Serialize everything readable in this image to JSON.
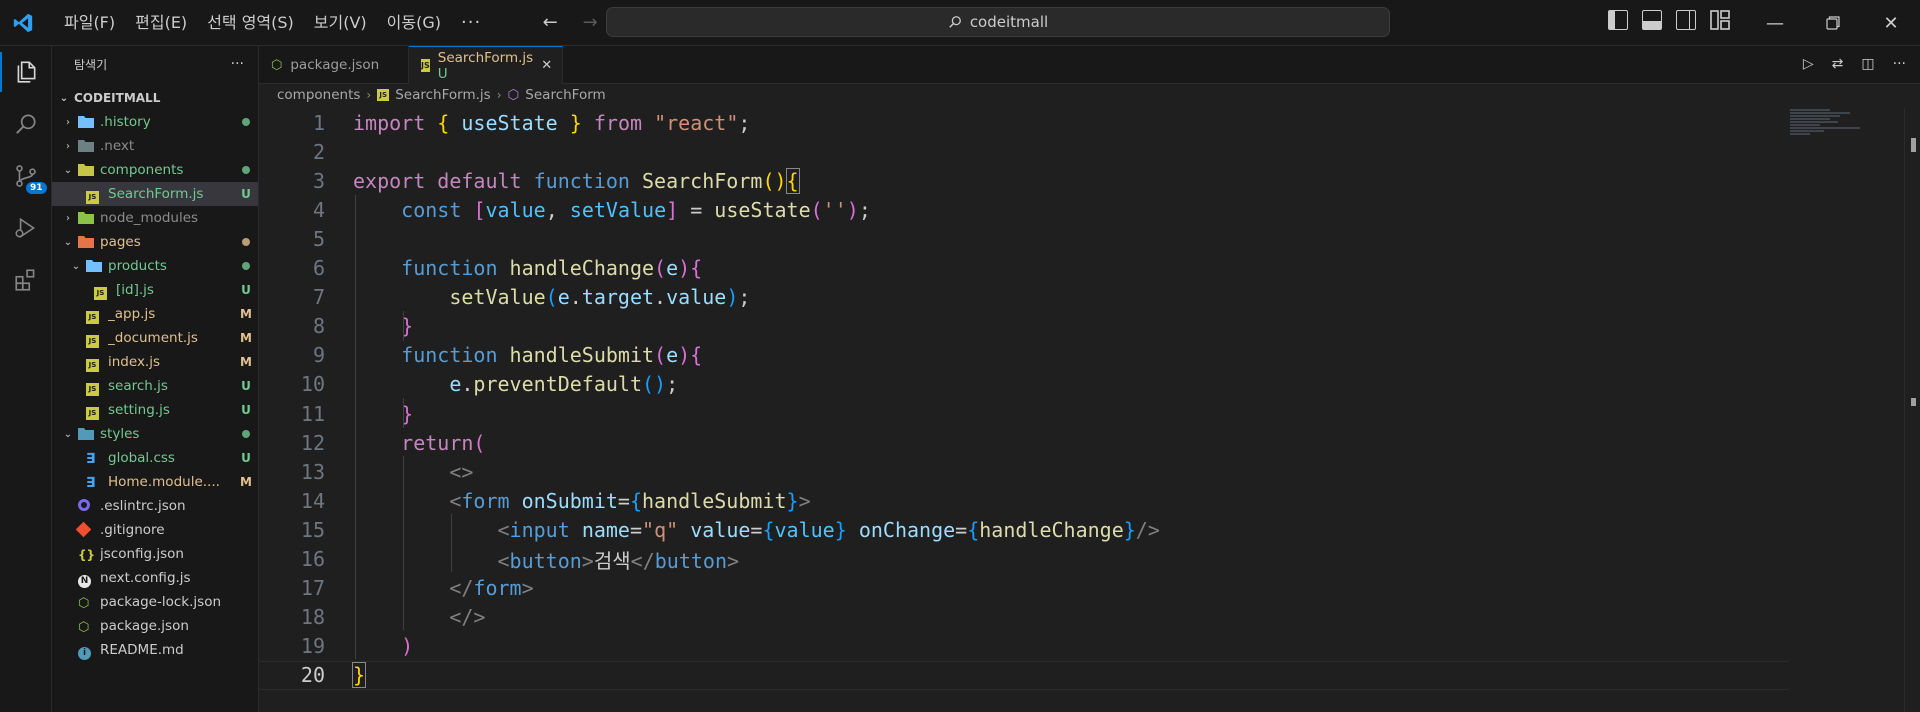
{
  "titlebar": {
    "menus": [
      "파일(F)",
      "편집(E)",
      "선택 영역(S)",
      "보기(V)",
      "이동(G)"
    ],
    "more": "···",
    "search": "codeitmall",
    "logo": "vscode-logo-icon"
  },
  "activity": {
    "scm_badge": "91"
  },
  "sidebar": {
    "title": "탐색기",
    "more": "···",
    "section": "CODEITMALL",
    "tree": [
      {
        "label": ".history",
        "status": "dot",
        "color": "#73c991"
      },
      {
        "label": ".next",
        "status": "",
        "color": "#8c8c8c"
      },
      {
        "label": "components",
        "status": "dot",
        "color": "#73c991"
      },
      {
        "label": "SearchForm.js",
        "status": "U",
        "color": "#73c991"
      },
      {
        "label": "node_modules",
        "status": "",
        "color": "#8c8c8c"
      },
      {
        "label": "pages",
        "status": "dot",
        "color": "#e2c08d"
      },
      {
        "label": "products",
        "status": "dot",
        "color": "#73c991"
      },
      {
        "label": "[id].js",
        "status": "U",
        "color": "#73c991"
      },
      {
        "label": "_app.js",
        "status": "M",
        "color": "#e2c08d"
      },
      {
        "label": "_document.js",
        "status": "M",
        "color": "#e2c08d"
      },
      {
        "label": "index.js",
        "status": "M",
        "color": "#e2c08d"
      },
      {
        "label": "search.js",
        "status": "U",
        "color": "#73c991"
      },
      {
        "label": "setting.js",
        "status": "U",
        "color": "#73c991"
      },
      {
        "label": "styles",
        "status": "dot",
        "color": "#73c991"
      },
      {
        "label": "global.css",
        "status": "U",
        "color": "#73c991"
      },
      {
        "label": "Home.module....",
        "status": "M",
        "color": "#e2c08d"
      },
      {
        "label": ".eslintrc.json",
        "status": "",
        "color": "#cccccc"
      },
      {
        "label": ".gitignore",
        "status": "",
        "color": "#cccccc"
      },
      {
        "label": "jsconfig.json",
        "status": "",
        "color": "#cccccc"
      },
      {
        "label": "next.config.js",
        "status": "",
        "color": "#cccccc"
      },
      {
        "label": "package-lock.json",
        "status": "",
        "color": "#cccccc"
      },
      {
        "label": "package.json",
        "status": "",
        "color": "#cccccc"
      },
      {
        "label": "README.md",
        "status": "",
        "color": "#cccccc"
      }
    ]
  },
  "tabs": [
    {
      "label": "package.json",
      "badge": ""
    },
    {
      "label": "SearchForm.js",
      "badge": "U",
      "close": "✕"
    }
  ],
  "breadcrumb": [
    "components",
    "SearchForm.js",
    "SearchForm"
  ],
  "editor": {
    "line_numbers": [
      "1",
      "2",
      "3",
      "4",
      "5",
      "6",
      "7",
      "8",
      "9",
      "10",
      "11",
      "12",
      "13",
      "14",
      "15",
      "16",
      "17",
      "18",
      "19",
      "20"
    ],
    "current_line": 20
  },
  "colors": {
    "accent": "#0078d4",
    "untracked": "#73c991",
    "modified": "#e2c08d"
  }
}
